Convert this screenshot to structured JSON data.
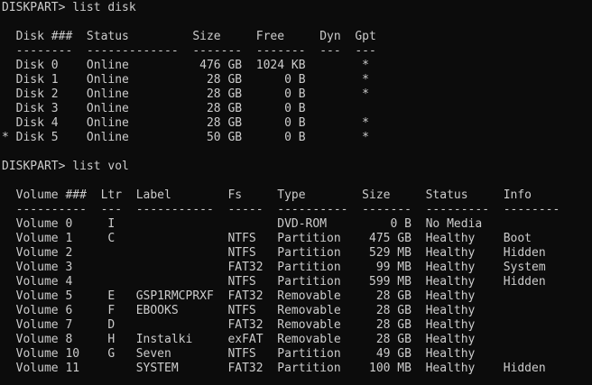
{
  "colors": {
    "background": "#0c0c0c",
    "text": "#cccccc"
  },
  "console": {
    "lines": [
      "DISKPART> list disk",
      "",
      "  Disk ###  Status         Size     Free     Dyn  Gpt",
      "  --------  -------------  -------  -------  ---  ---",
      "  Disk 0    Online          476 GB  1024 KB        *",
      "  Disk 1    Online           28 GB      0 B        *",
      "  Disk 2    Online           28 GB      0 B        *",
      "  Disk 3    Online           28 GB      0 B",
      "  Disk 4    Online           28 GB      0 B        *",
      "* Disk 5    Online           50 GB      0 B        *",
      "",
      "DISKPART> list vol",
      "",
      "  Volume ###  Ltr  Label        Fs     Type        Size     Status     Info",
      "  ----------  ---  -----------  -----  ----------  -------  ---------  --------",
      "  Volume 0     I                       DVD-ROM         0 B  No Media",
      "  Volume 1     C                NTFS   Partition    475 GB  Healthy    Boot",
      "  Volume 2                      NTFS   Partition    529 MB  Healthy    Hidden",
      "  Volume 3                      FAT32  Partition     99 MB  Healthy    System",
      "  Volume 4                      NTFS   Partition    599 MB  Healthy    Hidden",
      "  Volume 5     E   GSP1RMCPRXF  FAT32  Removable     28 GB  Healthy",
      "  Volume 6     F   EBOOKS       NTFS   Removable     28 GB  Healthy",
      "  Volume 7     D                FAT32  Removable     28 GB  Healthy",
      "  Volume 8     H   Instalki     exFAT  Removable     28 GB  Healthy",
      "  Volume 10    G   Seven        NTFS   Partition     49 GB  Healthy",
      "  Volume 11        SYSTEM       FAT32  Partition    100 MB  Healthy    Hidden"
    ]
  }
}
